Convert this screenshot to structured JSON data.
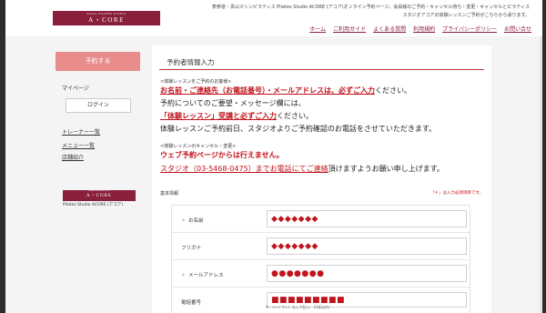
{
  "header": {
    "logo_sub": "ROYAL PILATES STUDIO",
    "logo_main": "A・CORE",
    "tagline_1": "表参道・青山マシンピラティス Pilates Studio ACORE (アコア)オンライン予約ページ。会員様のご予約・キャンセル待ち・変更・キャンセルとピラティス",
    "tagline_2": "スタジオアコアの体験レッスンご予約がこちらから承ります。",
    "nav": [
      "ホーム",
      "ご利用ガイド",
      "よくある質問",
      "利用規約",
      "プライバシーポリシー",
      "お問い合せ"
    ]
  },
  "sidebar": {
    "reserve_label": "予約する",
    "mypage_label": "マイページ",
    "login_label": "ログイン",
    "links": [
      "トレーナー一覧",
      "メニュー一覧",
      "店舗紹介"
    ],
    "logo_sub": "ROYAL PILATES STUDIO",
    "logo_main": "A・CORE",
    "caption": "Pilates Studio ACORE (アコア)"
  },
  "main": {
    "title": "予約者情報入力",
    "trial_head": "<体験レッスンをご予約のお客様>",
    "trial_line1_red": "お名前・ご連絡先（お電話番号）・メールアドレスは、必ずご入力",
    "trial_line1_tail": "ください。",
    "trial_line2": "予約についてのご要望・メッセージ欄には、",
    "trial_line3_red": "「体験レッスン」受講と必ずご入力",
    "trial_line3_tail": "ください。",
    "trial_line4": "体験レッスンご予約前日、スタジオよりご予約確認のお電話をさせていただきます。",
    "cancel_head": "<体験レッスンのキャンセル・変更>",
    "cancel_line1": "ウェブ予約ページからは行えません。",
    "cancel_line2_red": "スタジオ（03-5468-0475）までお電話にてご連絡",
    "cancel_line2_tail": "頂けますようお願い申し上げます。",
    "basic_label": "基本情報",
    "required_note": "「＊」は入力必須項目です。",
    "fields": [
      {
        "label": "お名前",
        "required": true,
        "value": "◆◆◆◆◆◆◆"
      },
      {
        "label": "フリガナ",
        "required": false,
        "value": "◆◆◆◆◆◆◆"
      },
      {
        "label": "メールアドレス",
        "required": true,
        "value": "●●●●●●●"
      },
      {
        "label": "電話番号",
        "required": false,
        "value": "■■■■■■■■■"
      }
    ],
    "phone_hint": "※-（ハイフン）なしで記入　11桁以内",
    "required_mark": "＊"
  },
  "colors": {
    "brand": "#8a1f3b",
    "accent_red": "#c0141c",
    "reserve_button": "#e88c8c"
  }
}
